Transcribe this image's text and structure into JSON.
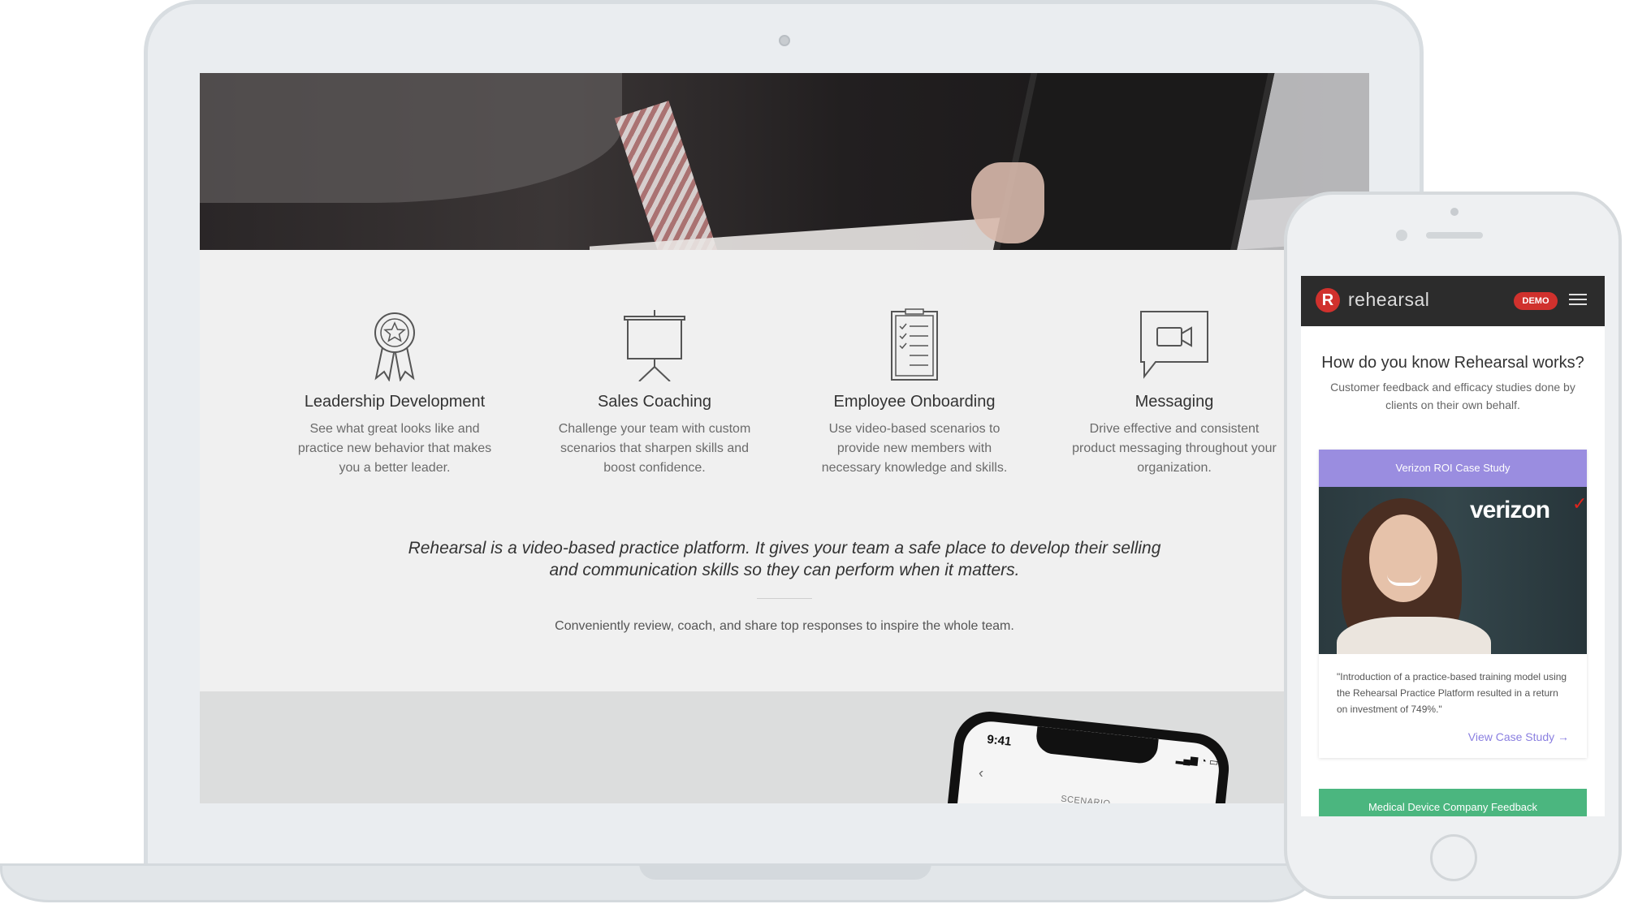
{
  "laptop": {
    "features": [
      {
        "icon": "award-ribbon-icon",
        "title": "Leadership Development",
        "desc": "See what great looks like and practice new behavior that makes you a better leader."
      },
      {
        "icon": "presentation-board-icon",
        "title": "Sales Coaching",
        "desc": "Challenge your team with custom scenarios that sharpen skills and boost confidence."
      },
      {
        "icon": "clipboard-checklist-icon",
        "title": "Employee Onboarding",
        "desc": "Use video-based scenarios to provide new members with necessary knowledge and skills."
      },
      {
        "icon": "video-chat-icon",
        "title": "Messaging",
        "desc": "Drive effective and consistent product messaging throughout your organization."
      }
    ],
    "tagline": "Rehearsal is a video-based practice platform. It gives your team a safe place to develop their selling and communication skills so they can perform when it matters.",
    "subline": "Conveniently review, coach, and share top responses to inspire the whole team.",
    "mini_phone": {
      "time": "9:41",
      "screen_label": "SCENARIO",
      "back_icon": "chevron-left-icon"
    }
  },
  "phone": {
    "brand": "rehearsal",
    "logo_letter": "R",
    "demo_label": "DEMO",
    "heading": "How do you know Rehearsal works?",
    "subheading": "Customer feedback and efficacy studies done by clients on their own behalf.",
    "case_card": {
      "header": "Verizon ROI Case Study",
      "brand_text": "verizon",
      "brand_check": "✓",
      "quote": "\"Introduction of a practice-based training model using the Rehearsal Practice Platform resulted in a return on investment of 749%.\"",
      "link": "View Case Study →"
    },
    "second_card_header": "Medical Device Company Feedback"
  },
  "colors": {
    "accent_red": "#d0312d",
    "purple": "#9a8de0",
    "green": "#4bb67f",
    "nav_dark": "#2c2c2c"
  }
}
